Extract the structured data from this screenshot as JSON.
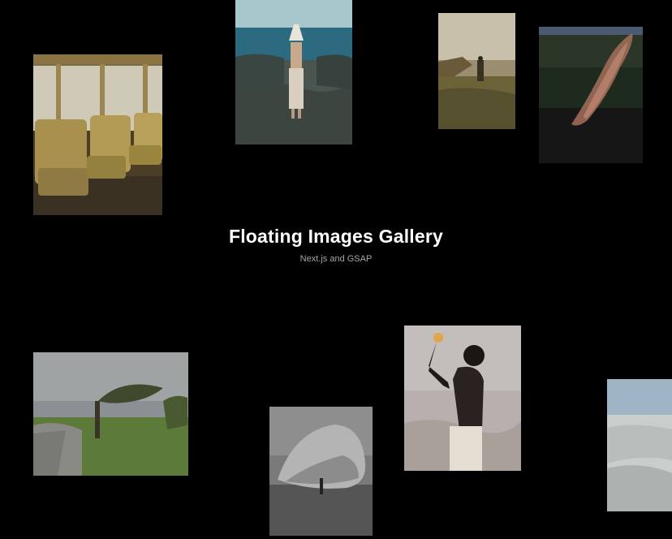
{
  "header": {
    "title": "Floating Images Gallery",
    "subtitle": "Next.js and GSAP"
  },
  "colors": {
    "background": "#000000",
    "title": "#ffffff",
    "subtitle": "#a6a6a6"
  },
  "gallery": {
    "images": [
      {
        "name": "train-seats-photo"
      },
      {
        "name": "woman-seaside-photo"
      },
      {
        "name": "man-cliff-sunset-photo"
      },
      {
        "name": "smoke-blur-photo"
      },
      {
        "name": "windswept-tree-photo"
      },
      {
        "name": "boulder-photo"
      },
      {
        "name": "man-salt-flats-photo"
      },
      {
        "name": "white-rocks-photo"
      }
    ]
  }
}
